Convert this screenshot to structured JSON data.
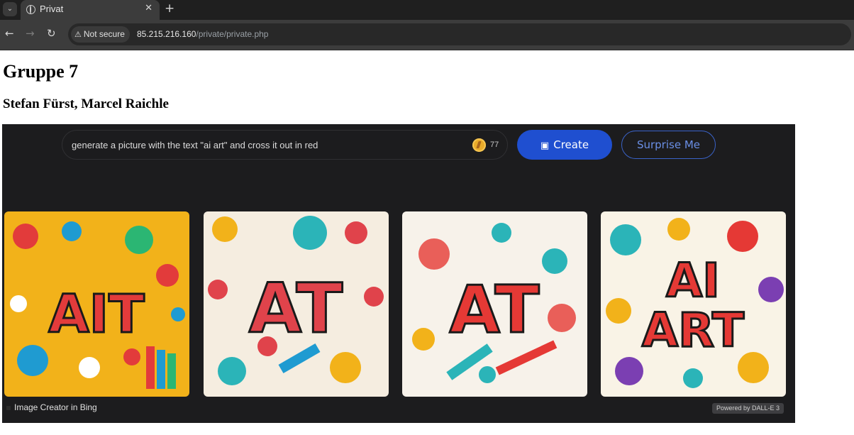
{
  "browser": {
    "tab": {
      "title": "Privat",
      "close_icon": "close-icon"
    },
    "tab_menu_icon": "chevron-down-icon",
    "new_tab_icon": "plus-icon",
    "nav": {
      "back_icon": "arrow-left-icon",
      "forward_icon": "arrow-right-icon",
      "reload_icon": "reload-icon"
    },
    "security_label": "Not secure",
    "url_host": "85.215.216.160",
    "url_path": "/private/private.php"
  },
  "page": {
    "title": "Gruppe 7",
    "subtitle": "Stefan Fürst, Marcel Raichle"
  },
  "image_creator": {
    "prompt_text": "generate a picture with the text \"ai art\" and cross it out in red",
    "boost_count": "77",
    "create_label": "Create",
    "surprise_label": "Surprise Me",
    "footer_label": "Image Creator in Bing",
    "powered_label": "Powered by DALL-E 3",
    "images": [
      {
        "text": "AIT",
        "bg": "#f2b21a",
        "accent": "#e23b3b"
      },
      {
        "text": "AT",
        "bg": "#f5ede0",
        "accent": "#e0434b"
      },
      {
        "text": "AT",
        "bg": "#f7f2ea",
        "accent": "#e53935"
      },
      {
        "text": "AI ART",
        "bg": "#f9f3e6",
        "accent": "#e53935"
      }
    ]
  },
  "colors": {
    "create_button": "#1f4fd0",
    "surprise_border": "#3a63c9",
    "panel_bg": "#1c1c1e"
  }
}
